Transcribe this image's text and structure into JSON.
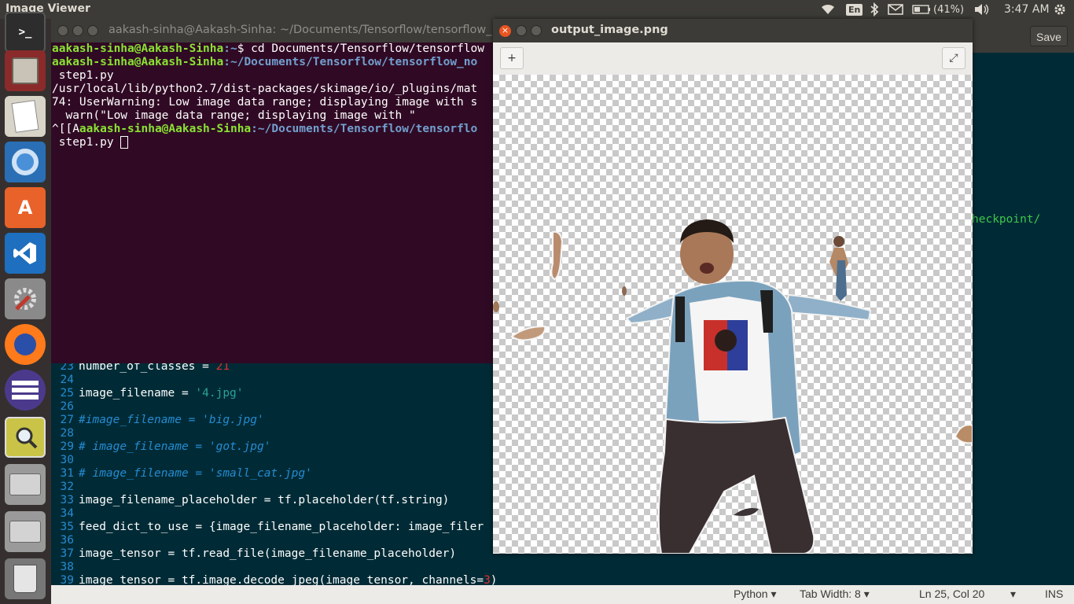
{
  "top_panel": {
    "app_title": "Image Viewer",
    "keyboard_layout": "En",
    "battery": "(41%)",
    "clock": "3:47 AM"
  },
  "launcher": {
    "items": [
      "Terminal",
      "Files",
      "Text Editor",
      "Chromium",
      "Ubuntu Software",
      "Visual Studio Code",
      "System Settings",
      "Firefox",
      "Eclipse",
      "Image Viewer",
      "Drive 1",
      "Drive 2",
      "Trash"
    ]
  },
  "editor": {
    "save_label": "Save",
    "right_snippet": "heckpoint/",
    "code": [
      {
        "ln": "23",
        "parts": [
          [
            "t",
            "number_of_classes = "
          ],
          [
            "n",
            "21"
          ]
        ]
      },
      {
        "ln": "24",
        "parts": []
      },
      {
        "ln": "25",
        "parts": [
          [
            "t",
            "image_filename = "
          ],
          [
            "s",
            "'4.jpg'"
          ]
        ]
      },
      {
        "ln": "26",
        "parts": []
      },
      {
        "ln": "27",
        "parts": [
          [
            "c",
            "#image_filename = 'big.jpg'"
          ]
        ]
      },
      {
        "ln": "28",
        "parts": []
      },
      {
        "ln": "29",
        "parts": [
          [
            "c",
            "# image_filename = 'got.jpg'"
          ]
        ]
      },
      {
        "ln": "30",
        "parts": []
      },
      {
        "ln": "31",
        "parts": [
          [
            "c",
            "# image_filename = 'small_cat.jpg'"
          ]
        ]
      },
      {
        "ln": "32",
        "parts": []
      },
      {
        "ln": "33",
        "parts": [
          [
            "t",
            "image_filename_placeholder = tf.placeholder(tf.string)"
          ]
        ]
      },
      {
        "ln": "34",
        "parts": []
      },
      {
        "ln": "35",
        "parts": [
          [
            "t",
            "feed_dict_to_use = {image_filename_placeholder: image_filer"
          ]
        ]
      },
      {
        "ln": "36",
        "parts": []
      },
      {
        "ln": "37",
        "parts": [
          [
            "t",
            "image_tensor = tf.read_file(image_filename_placeholder)"
          ]
        ]
      },
      {
        "ln": "38",
        "parts": []
      },
      {
        "ln": "39",
        "parts": [
          [
            "t",
            "image_tensor = tf.image.decode_jpeg(image_tensor, channels="
          ],
          [
            "n",
            "3"
          ],
          [
            "t",
            ")"
          ]
        ]
      }
    ],
    "status": {
      "language": "Python",
      "tab_width": "Tab Width: 8",
      "position": "Ln 25, Col 20",
      "mode": "INS"
    }
  },
  "terminal": {
    "title": "aakash-sinha@Aakash-Sinha: ~/Documents/Tensorflow/tensorflow_",
    "lines": [
      {
        "user": "aakash-sinha@Aakash-Sinha",
        "path": ":~",
        "text": "$ cd Documents/Tensorflow/tensorflow"
      },
      {
        "user": "aakash-sinha@Aakash-Sinha",
        "path": ":~/Documents/Tensorflow/tensorflow_no",
        "text": ""
      },
      {
        "user": "",
        "path": "",
        "text": " step1.py"
      },
      {
        "user": "",
        "path": "",
        "text": "/usr/local/lib/python2.7/dist-packages/skimage/io/_plugins/mat"
      },
      {
        "user": "",
        "path": "",
        "text": "74: UserWarning: Low image data range; displaying image with s"
      },
      {
        "user": "",
        "path": "",
        "text": "  warn(\"Low image data range; displaying image with \""
      },
      {
        "pre": "^[[A",
        "user": "aakash-sinha@Aakash-Sinha",
        "path": ":~/Documents/Tensorflow/tensorflo",
        "text": ""
      },
      {
        "user": "",
        "path": "",
        "text": " step1.py ",
        "cursor": true
      }
    ]
  },
  "viewer": {
    "title": "output_image.png",
    "add_label": "+",
    "fullscreen_label": "⤢"
  }
}
